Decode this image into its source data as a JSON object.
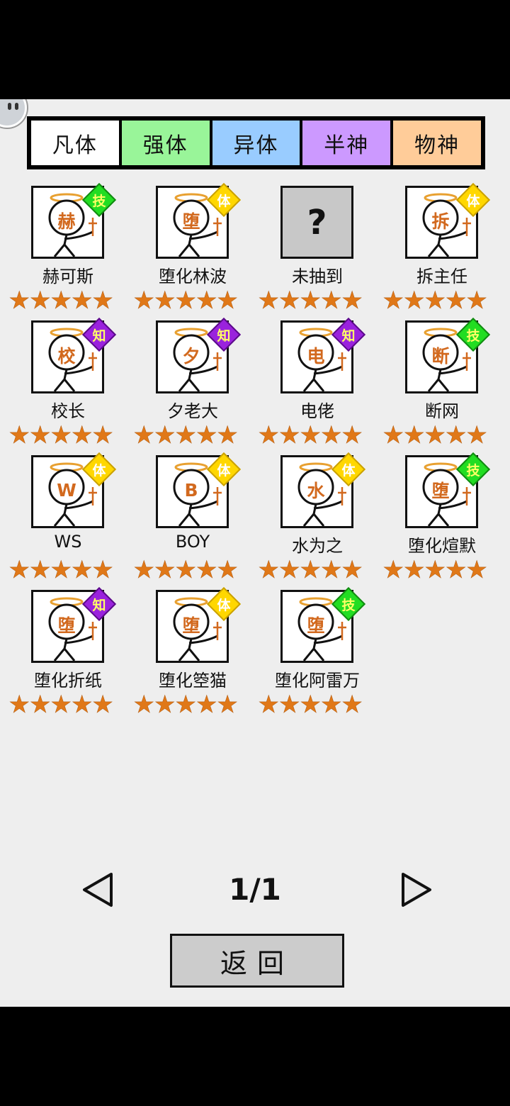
{
  "tabs": [
    {
      "label": "凡体",
      "color": "#ffffff"
    },
    {
      "label": "强体",
      "color": "#99f599"
    },
    {
      "label": "异体",
      "color": "#99ccff"
    },
    {
      "label": "半神",
      "color": "#cc99ff"
    },
    {
      "label": "物神",
      "color": "#ffcc99"
    }
  ],
  "characters": [
    {
      "name": "赫可斯",
      "face": "赫",
      "badge": "技",
      "badge_type": "skill",
      "stars": 5
    },
    {
      "name": "堕化林波",
      "face": "堕",
      "badge": "体",
      "badge_type": "body",
      "stars": 5
    },
    {
      "name": "未抽到",
      "face": "?",
      "badge": "",
      "badge_type": "none",
      "stars": 5,
      "locked": true
    },
    {
      "name": "拆主任",
      "face": "拆",
      "badge": "体",
      "badge_type": "body",
      "stars": 5
    },
    {
      "name": "校长",
      "face": "校",
      "badge": "知",
      "badge_type": "knowledge",
      "stars": 5
    },
    {
      "name": "夕老大",
      "face": "夕",
      "badge": "知",
      "badge_type": "knowledge",
      "stars": 5
    },
    {
      "name": "电佬",
      "face": "电",
      "badge": "知",
      "badge_type": "knowledge",
      "stars": 5
    },
    {
      "name": "断网",
      "face": "断",
      "badge": "技",
      "badge_type": "skill",
      "stars": 5
    },
    {
      "name": "WS",
      "face": "W",
      "badge": "体",
      "badge_type": "body",
      "stars": 5
    },
    {
      "name": "BOY",
      "face": "B",
      "badge": "体",
      "badge_type": "body",
      "stars": 5
    },
    {
      "name": "水为之",
      "face": "水",
      "badge": "体",
      "badge_type": "body",
      "stars": 5
    },
    {
      "name": "堕化煊默",
      "face": "堕",
      "badge": "技",
      "badge_type": "skill",
      "stars": 5
    },
    {
      "name": "堕化折纸",
      "face": "堕",
      "badge": "知",
      "badge_type": "knowledge",
      "stars": 5
    },
    {
      "name": "堕化箜猫",
      "face": "堕",
      "badge": "体",
      "badge_type": "body",
      "stars": 5
    },
    {
      "name": "堕化阿雷万",
      "face": "堕",
      "badge": "技",
      "badge_type": "skill",
      "stars": 5
    }
  ],
  "badge_colors": {
    "skill": {
      "fill": "#22dd22",
      "border": "#118811",
      "text": "#ffff66"
    },
    "body": {
      "fill": "#ffd700",
      "border": "#c9a000",
      "text": "#ffffff"
    },
    "knowledge": {
      "fill": "#9a22dd",
      "border": "#5a0a88",
      "text": "#ffff66"
    }
  },
  "pagination": {
    "page_text": "1/1",
    "prev_icon": "triangle-left-icon",
    "next_icon": "triangle-right-icon"
  },
  "back_button": {
    "label": "返回"
  }
}
